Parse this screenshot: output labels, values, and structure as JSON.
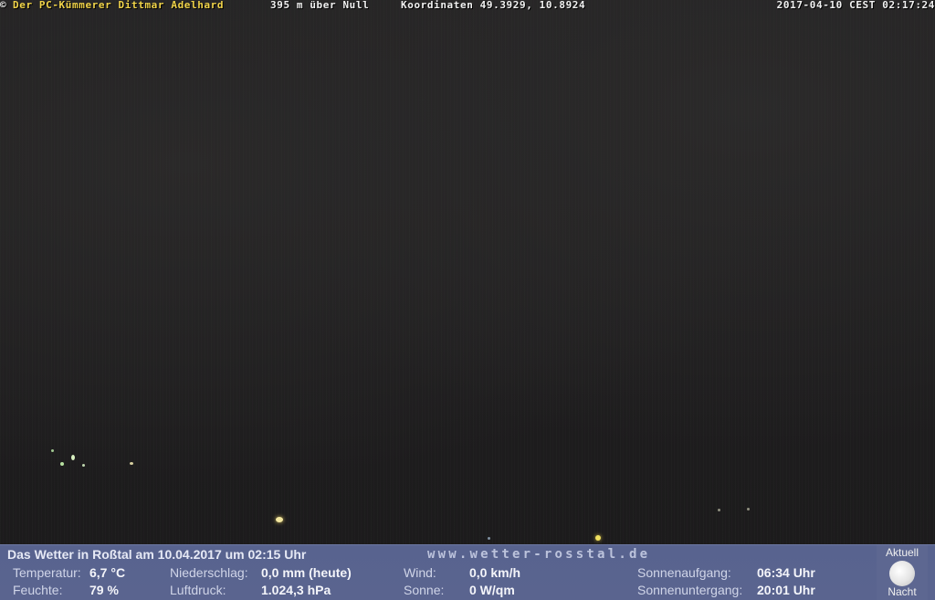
{
  "overlay": {
    "copyright": "©",
    "owner": "Der PC-Kümmerer Dittmar Adelhard",
    "altitude": "395 m über Null",
    "coordinates": "Koordinaten 49.3929, 10.8924",
    "timestamp": "2017-04-10 CEST 02:17:24"
  },
  "weather": {
    "title": "Das Wetter in Roßtal am 10.04.2017 um 02:15 Uhr",
    "website": "www.wetter-rosstal.de",
    "rows": [
      {
        "temperature_label": "Temperatur:",
        "temperature_value": "6,7 °C",
        "precip_label": "Niederschlag:",
        "precip_value": "0,0 mm (heute)",
        "wind_label": "Wind:",
        "wind_value": "0,0 km/h",
        "sunrise_label": "Sonnenaufgang:",
        "sunrise_value": "06:34 Uhr"
      },
      {
        "humidity_label": "Feuchte:",
        "humidity_value": "79 %",
        "pressure_label": "Luftdruck:",
        "pressure_value": "1.024,3 hPa",
        "sun_label": "Sonne:",
        "sun_value": "0 W/qm",
        "sunset_label": "Sonnenuntergang:",
        "sunset_value": "20:01 Uhr"
      }
    ],
    "moon": {
      "top_label": "Aktuell",
      "bottom_label": "Nacht",
      "icon": "moon-icon"
    }
  },
  "colors": {
    "panel_bg": "#5a648f",
    "owner_text": "#f1d44a",
    "overlay_text": "#f2f2f2"
  }
}
